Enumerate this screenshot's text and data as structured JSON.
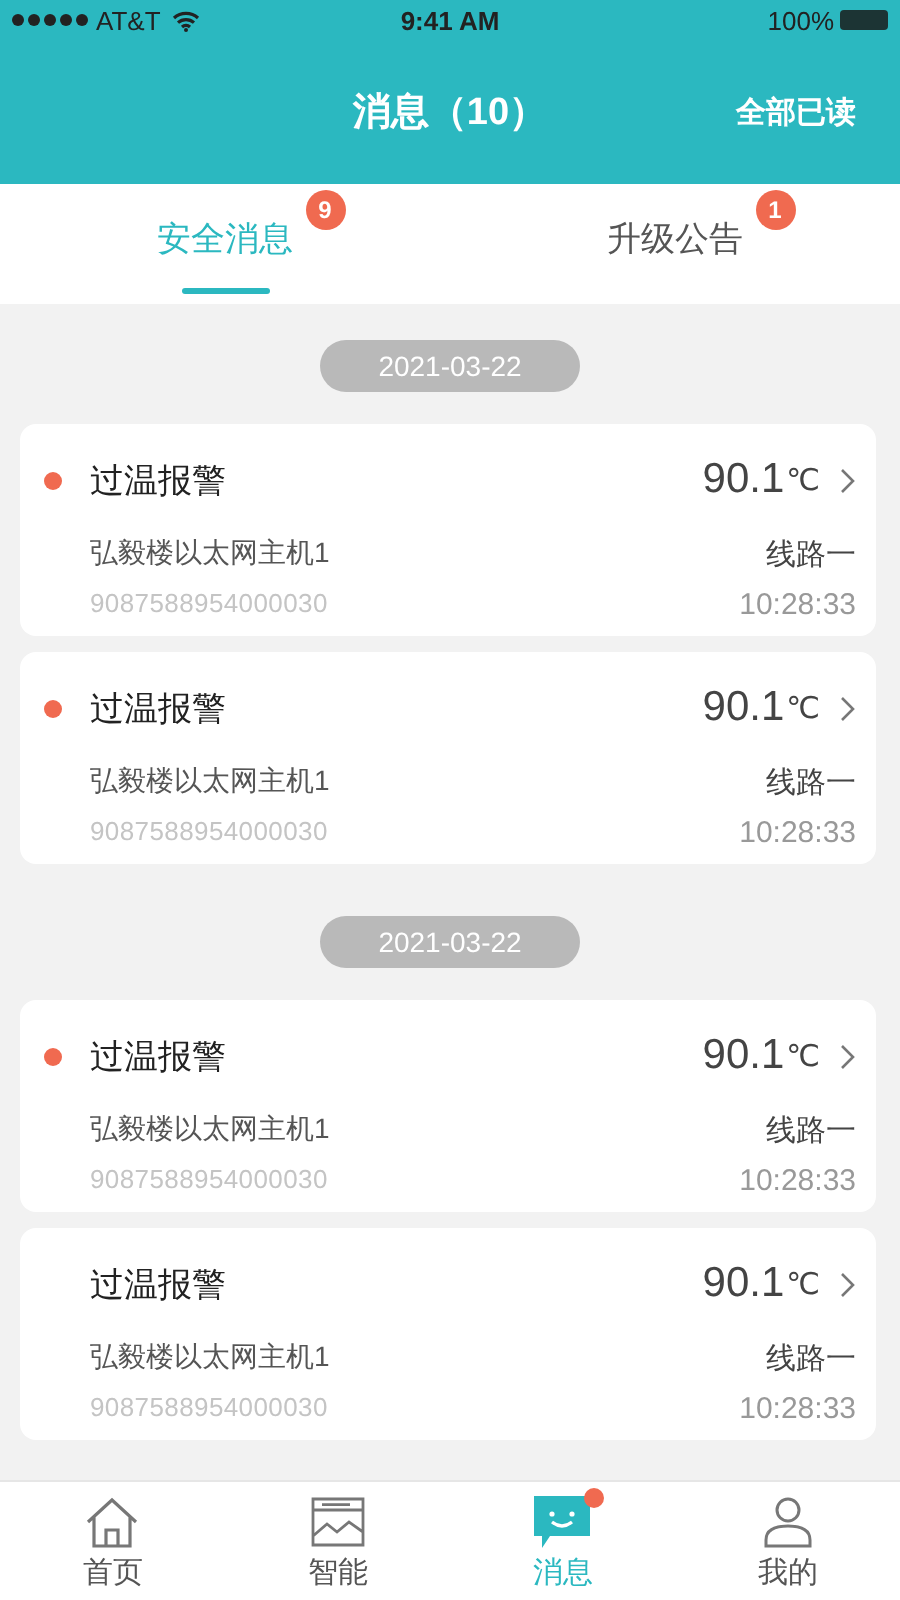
{
  "status_bar": {
    "carrier": "AT&T",
    "time": "9:41 AM",
    "battery": "100%"
  },
  "nav": {
    "title": "消息（10）",
    "action": "全部已读"
  },
  "tabs": [
    {
      "label": "安全消息",
      "badge": "9",
      "selected": true
    },
    {
      "label": "升级公告",
      "badge": "1",
      "selected": false
    }
  ],
  "groups": [
    {
      "date": "2021-03-22",
      "messages": [
        {
          "title": "过温报警",
          "unread": true,
          "value": "90.1",
          "unit": "℃",
          "device": "弘毅楼以太网主机1",
          "serial": "9087588954000030",
          "line": "线路一",
          "time": "10:28:33"
        },
        {
          "title": "过温报警",
          "unread": true,
          "value": "90.1",
          "unit": "℃",
          "device": "弘毅楼以太网主机1",
          "serial": "9087588954000030",
          "line": "线路一",
          "time": "10:28:33"
        }
      ]
    },
    {
      "date": "2021-03-22",
      "messages": [
        {
          "title": "过温报警",
          "unread": true,
          "value": "90.1",
          "unit": "℃",
          "device": "弘毅楼以太网主机1",
          "serial": "9087588954000030",
          "line": "线路一",
          "time": "10:28:33"
        },
        {
          "title": "过温报警",
          "unread": false,
          "value": "90.1",
          "unit": "℃",
          "device": "弘毅楼以太网主机1",
          "serial": "9087588954000030",
          "line": "线路一",
          "time": "10:28:33"
        }
      ]
    }
  ],
  "bottom_nav": [
    {
      "kind": "home",
      "label": "首页",
      "selected": false,
      "dot": false
    },
    {
      "kind": "chart",
      "label": "智能",
      "selected": false,
      "dot": false
    },
    {
      "kind": "message",
      "label": "消息",
      "selected": true,
      "dot": true
    },
    {
      "kind": "user",
      "label": "我的",
      "selected": false,
      "dot": false
    }
  ]
}
